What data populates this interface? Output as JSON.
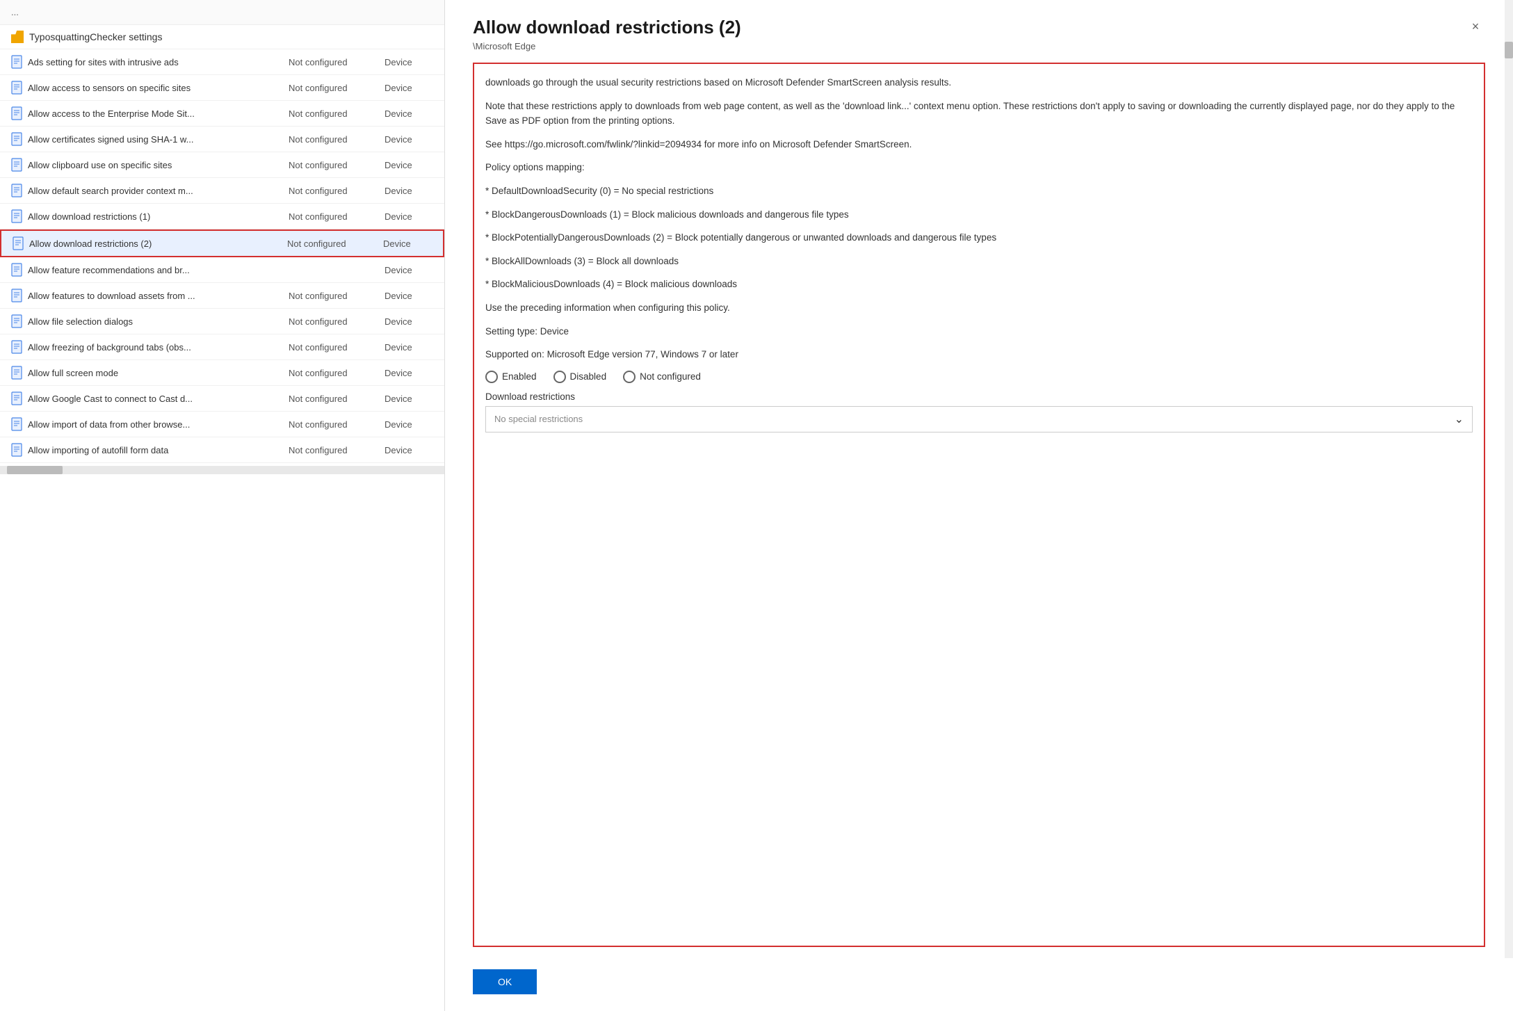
{
  "leftPanel": {
    "headerText": "...",
    "folderItem": {
      "label": "TyposquattingChecker settings"
    },
    "policyRows": [
      {
        "name": "Ads setting for sites with intrusive ads",
        "status": "Not configured",
        "scope": "Device"
      },
      {
        "name": "Allow access to sensors on specific sites",
        "status": "Not configured",
        "scope": "Device"
      },
      {
        "name": "Allow access to the Enterprise Mode Sit...",
        "status": "Not configured",
        "scope": "Device"
      },
      {
        "name": "Allow certificates signed using SHA-1 w...",
        "status": "Not configured",
        "scope": "Device"
      },
      {
        "name": "Allow clipboard use on specific sites",
        "status": "Not configured",
        "scope": "Device"
      },
      {
        "name": "Allow default search provider context m...",
        "status": "Not configured",
        "scope": "Device"
      },
      {
        "name": "Allow download restrictions (1)",
        "status": "Not configured",
        "scope": "Device"
      },
      {
        "name": "Allow download restrictions (2)",
        "status": "Not configured",
        "scope": "Device",
        "selected": true
      },
      {
        "name": "Allow feature recommendations and br...",
        "status": "",
        "scope": "Device"
      },
      {
        "name": "Allow features to download assets from ...",
        "status": "Not configured",
        "scope": "Device"
      },
      {
        "name": "Allow file selection dialogs",
        "status": "Not configured",
        "scope": "Device"
      },
      {
        "name": "Allow freezing of background tabs (obs...",
        "status": "Not configured",
        "scope": "Device"
      },
      {
        "name": "Allow full screen mode",
        "status": "Not configured",
        "scope": "Device"
      },
      {
        "name": "Allow Google Cast to connect to Cast d...",
        "status": "Not configured",
        "scope": "Device"
      },
      {
        "name": "Allow import of data from other browse...",
        "status": "Not configured",
        "scope": "Device"
      },
      {
        "name": "Allow importing of autofill form data",
        "status": "Not configured",
        "scope": "Device"
      }
    ]
  },
  "detailPanel": {
    "title": "Allow download restrictions (2)",
    "breadcrumb": "\\Microsoft Edge",
    "closeLabel": "×",
    "description": {
      "para1": "downloads go through the usual security restrictions based on Microsoft Defender SmartScreen analysis results.",
      "para2": "Note that these restrictions apply to downloads from web page content, as well as the 'download link...' context menu option. These restrictions don't apply to saving or downloading the currently displayed page, nor do they apply to the Save as PDF option from the printing options.",
      "para3": "See https://go.microsoft.com/fwlink/?linkid=2094934 for more info on Microsoft Defender SmartScreen.",
      "para4": "Policy options mapping:",
      "option0": "* DefaultDownloadSecurity (0) = No special restrictions",
      "option1": "* BlockDangerousDownloads (1) = Block malicious downloads and dangerous file types",
      "option2": "* BlockPotentiallyDangerousDownloads (2) = Block potentially dangerous or unwanted downloads and dangerous file types",
      "option3": "* BlockAllDownloads (3) = Block all downloads",
      "option4": "* BlockMaliciousDownloads (4) = Block malicious downloads",
      "para5": "Use the preceding information when configuring this policy.",
      "para6": "Setting type: Device",
      "para7": "Supported on: Microsoft Edge version 77, Windows 7 or later"
    },
    "radioOptions": {
      "enabled": "Enabled",
      "disabled": "Disabled",
      "notConfigured": "Not configured"
    },
    "dropdownSection": {
      "label": "Download restrictions",
      "placeholder": "No special restrictions"
    },
    "okButton": "OK"
  }
}
